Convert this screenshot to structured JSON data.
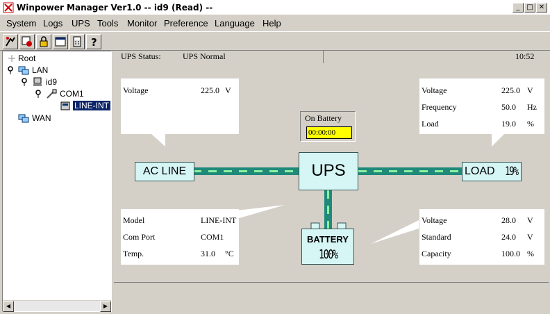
{
  "window": {
    "title": "Winpower Manager Ver1.0 -- id9 (Read) --",
    "minimize": "_",
    "maximize": "□",
    "close": "✕"
  },
  "menu": [
    "System",
    "Logs",
    "UPS",
    "Tools",
    "Monitor",
    "Preference",
    "Language",
    "Help"
  ],
  "tree": {
    "root": "Root",
    "lan": "LAN",
    "host": "id9",
    "port": "COM1",
    "device": "LINE-INT",
    "wan": "WAN"
  },
  "status": {
    "label": "UPS Status:",
    "value": "UPS Normal",
    "time": "10:52"
  },
  "input": {
    "voltage_label": "Voltage",
    "voltage_value": "225.0",
    "voltage_unit": "V"
  },
  "output": {
    "voltage_label": "Voltage",
    "voltage_value": "225.0",
    "voltage_unit": "V",
    "frequency_label": "Frequency",
    "frequency_value": "50.0",
    "frequency_unit": "Hz",
    "load_label": "Load",
    "load_value": "19.0",
    "load_unit": "%"
  },
  "onbattery": {
    "label": "On Battery",
    "time": "00:00:00"
  },
  "diagram": {
    "acline": "AC LINE",
    "ups": "UPS",
    "load": "LOAD",
    "load_pct": "19%",
    "battery": "BATTERY",
    "battery_pct": "100%"
  },
  "device": {
    "model_label": "Model",
    "model_value": "LINE-INT",
    "port_label": "Com Port",
    "port_value": "COM1",
    "temp_label": "Temp.",
    "temp_value": "31.0",
    "temp_unit": "°C"
  },
  "battery": {
    "voltage_label": "Voltage",
    "voltage_value": "28.0",
    "voltage_unit": "V",
    "standard_label": "Standard",
    "standard_value": "24.0",
    "standard_unit": "V",
    "capacity_label": "Capacity",
    "capacity_value": "100.0",
    "capacity_unit": "%"
  },
  "colors": {
    "accent_line": "#1f8a7a",
    "line_dash": "#8cf0a0",
    "box_fill": "#d6f5f5",
    "timer_bg": "#ffff00",
    "selection": "#0a246a"
  },
  "icons": [
    "connect-icon",
    "disconnect-icon",
    "lock-icon",
    "window-icon",
    "calculator-icon",
    "help-icon"
  ]
}
